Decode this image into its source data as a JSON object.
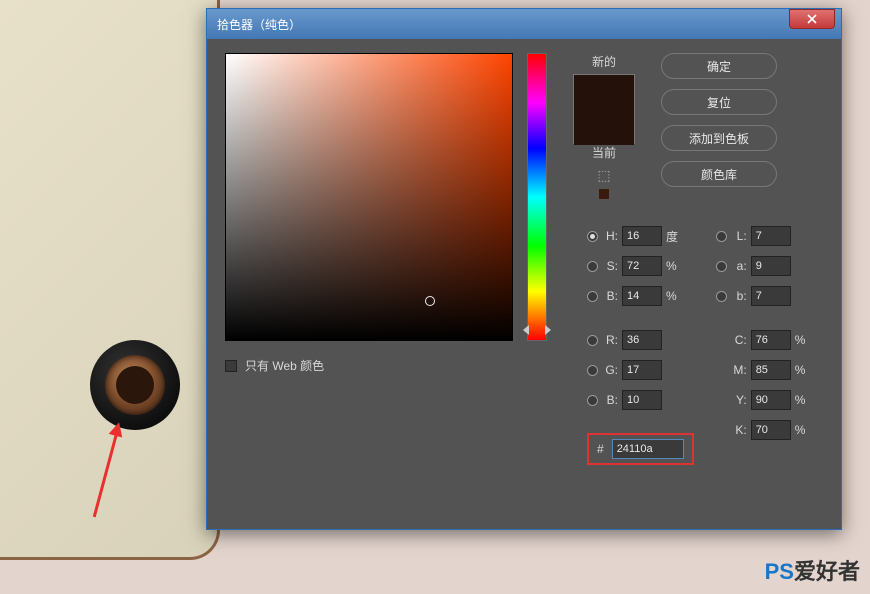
{
  "dialog": {
    "title": "拾色器（纯色）",
    "buttons": {
      "ok": "确定",
      "reset": "复位",
      "add": "添加到色板",
      "lib": "颜色库"
    },
    "swatch": {
      "new_label": "新的",
      "cur_label": "当前",
      "new_color": "#24110a",
      "cur_color": "#24110a"
    },
    "web_only": "只有 Web 颜色",
    "hsb": {
      "h": {
        "label": "H:",
        "value": "16",
        "unit": "度"
      },
      "s": {
        "label": "S:",
        "value": "72",
        "unit": "%"
      },
      "b": {
        "label": "B:",
        "value": "14",
        "unit": "%"
      }
    },
    "rgb": {
      "r": {
        "label": "R:",
        "value": "36"
      },
      "g": {
        "label": "G:",
        "value": "17"
      },
      "b": {
        "label": "B:",
        "value": "10"
      }
    },
    "lab": {
      "l": {
        "label": "L:",
        "value": "7"
      },
      "a": {
        "label": "a:",
        "value": "9"
      },
      "b": {
        "label": "b:",
        "value": "7"
      }
    },
    "cmyk": {
      "c": {
        "label": "C:",
        "value": "76",
        "unit": "%"
      },
      "m": {
        "label": "M:",
        "value": "85",
        "unit": "%"
      },
      "y": {
        "label": "Y:",
        "value": "90",
        "unit": "%"
      },
      "k": {
        "label": "K:",
        "value": "70",
        "unit": "%"
      }
    },
    "hex": {
      "hash": "#",
      "value": "24110a"
    }
  },
  "watermark": {
    "ps": "PS",
    "rest": "爱好者"
  }
}
